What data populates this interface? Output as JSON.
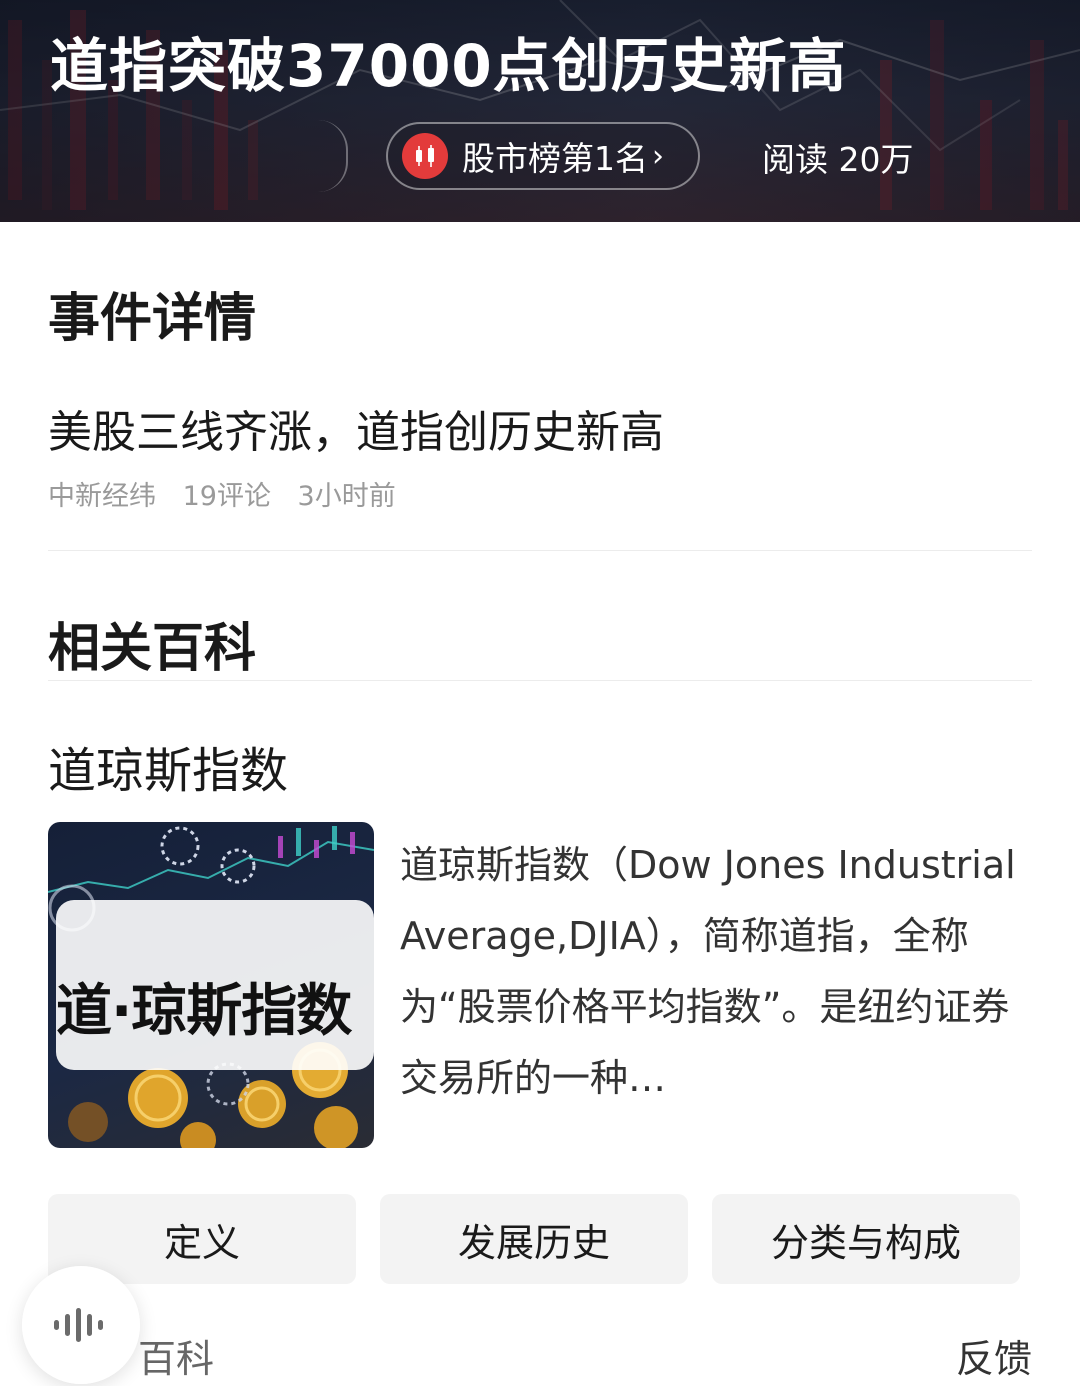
{
  "banner": {
    "title": "道指突破37000点创历史新高",
    "rank_label": "股市榜第1名",
    "rank_chevron": "›",
    "reads": "阅读 20万"
  },
  "event": {
    "heading": "事件详情",
    "news_title": "美股三线齐涨，道指创历史新高",
    "source": "中新经纬",
    "comments": "19评论",
    "time": "3小时前"
  },
  "wiki": {
    "heading": "相关百科",
    "entry_title": "道琼斯指数",
    "thumb_label": "道·琼斯指数",
    "description": "道琼斯指数（Dow Jones Industrial Average,DJIA），简称道指，全称为“股票价格平均指数”。是纽约证券交易所的一种…",
    "tabs": [
      "定义",
      "发展历史",
      "分类与构成"
    ]
  },
  "footer": {
    "left_label": "百科",
    "right_label": "反馈"
  },
  "icons": {
    "rank": "candlestick-icon",
    "voice": "voice-wave-icon"
  },
  "colors": {
    "accent_red": "#e33b3b",
    "muted_text": "#9a9a9a",
    "tab_bg": "#f3f3f3"
  }
}
